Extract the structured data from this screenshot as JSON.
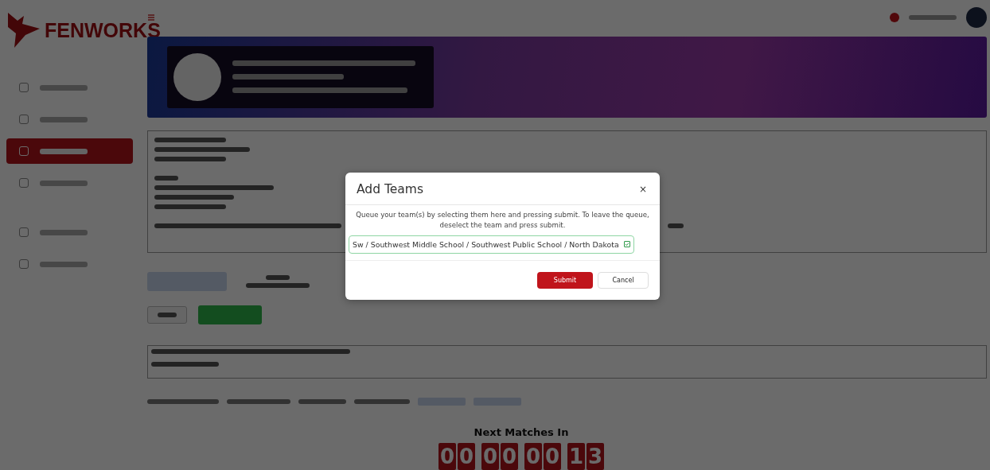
{
  "sidebar": {
    "logo": "FENWORKS",
    "nav_items": [
      {
        "selected": false
      },
      {
        "selected": false
      },
      {
        "selected": true
      },
      {
        "selected": false
      },
      {
        "selected": false
      },
      {
        "selected": false
      }
    ]
  },
  "countdown": {
    "title": "Next Matches In",
    "groups": [
      {
        "digits": [
          "0",
          "0"
        ]
      },
      {
        "digits": [
          "0",
          "0"
        ]
      },
      {
        "digits": [
          "0",
          "0"
        ]
      },
      {
        "digits": [
          "1",
          "3"
        ]
      }
    ]
  },
  "modal": {
    "title": "Add Teams",
    "close": "×",
    "description": "Queue your team(s) by selecting them here and pressing submit. To leave the queue, deselect the team and press submit.",
    "teams": [
      {
        "label": "Sw / Southwest Middle School / Southwest Public School / North Dakota",
        "checked": true
      }
    ],
    "buttons": [
      {
        "label": "Submit",
        "kind": "primary"
      },
      {
        "label": "Cancel",
        "kind": "secondary"
      }
    ]
  }
}
